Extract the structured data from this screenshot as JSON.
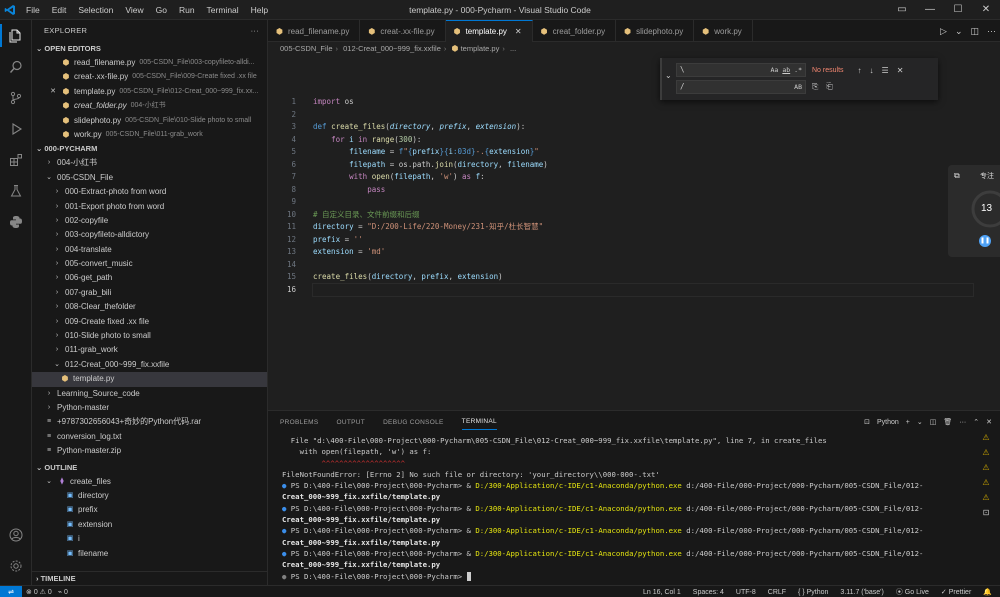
{
  "window": {
    "title": "template.py - 000-Pycharm - Visual Studio Code",
    "menu": [
      "File",
      "Edit",
      "Selection",
      "View",
      "Go",
      "Run",
      "Terminal",
      "Help"
    ]
  },
  "sidebar": {
    "title": "EXPLORER",
    "open_editors_header": "OPEN EDITORS",
    "open_editors": [
      {
        "name": "read_filename.py",
        "desc": "005-CSDN_File\\003-copyfileto-alldi..."
      },
      {
        "name": "creat-.xx-file.py",
        "desc": "005-CSDN_File\\009-Create fixed .xx file"
      },
      {
        "name": "template.py",
        "desc": "005-CSDN_File\\012-Creat_000~999_fix.xx..."
      },
      {
        "name": "creat_folder.py",
        "desc": "004-小红书"
      },
      {
        "name": "slidephoto.py",
        "desc": "005-CSDN_File\\010-Slide photo to small"
      },
      {
        "name": "work.py",
        "desc": "005-CSDN_File\\011-grab_work"
      }
    ],
    "workspace_header": "000-PYCHARM",
    "tree": [
      {
        "label": "004-小红书",
        "depth": 1,
        "kind": "chev-right"
      },
      {
        "label": "005-CSDN_File",
        "depth": 1,
        "kind": "chev-down"
      },
      {
        "label": "000-Extract-photo from word",
        "depth": 2,
        "kind": "chev-right"
      },
      {
        "label": "001-Export photo from word",
        "depth": 2,
        "kind": "chev-right"
      },
      {
        "label": "002-copyfile",
        "depth": 2,
        "kind": "chev-right"
      },
      {
        "label": "003-copyfileto-alldictory",
        "depth": 2,
        "kind": "chev-right"
      },
      {
        "label": "004-translate",
        "depth": 2,
        "kind": "chev-right"
      },
      {
        "label": "005-convert_music",
        "depth": 2,
        "kind": "chev-right"
      },
      {
        "label": "006-get_path",
        "depth": 2,
        "kind": "chev-right"
      },
      {
        "label": "007-grab_bili",
        "depth": 2,
        "kind": "chev-right"
      },
      {
        "label": "008-Clear_thefolder",
        "depth": 2,
        "kind": "chev-right"
      },
      {
        "label": "009-Create fixed .xx file",
        "depth": 2,
        "kind": "chev-right"
      },
      {
        "label": "010-Slide photo to small",
        "depth": 2,
        "kind": "chev-right"
      },
      {
        "label": "011-grab_work",
        "depth": 2,
        "kind": "chev-right"
      },
      {
        "label": "012-Creat_000~999_fix.xxfile",
        "depth": 2,
        "kind": "chev-down"
      },
      {
        "label": "template.py",
        "depth": 3,
        "kind": "py",
        "selected": true
      },
      {
        "label": "Learning_Source_code",
        "depth": 1,
        "kind": "chev-right"
      },
      {
        "label": "Python-master",
        "depth": 1,
        "kind": "chev-right"
      },
      {
        "label": "+9787302656043+奇妙的Python代码.rar",
        "depth": 1,
        "kind": "file"
      },
      {
        "label": "conversion_log.txt",
        "depth": 1,
        "kind": "file"
      },
      {
        "label": "Python-master.zip",
        "depth": 1,
        "kind": "file"
      }
    ],
    "outline_header": "OUTLINE",
    "outline": [
      {
        "label": "create_files",
        "depth": 1,
        "kind": "func"
      },
      {
        "label": "directory",
        "depth": 2,
        "kind": "var"
      },
      {
        "label": "prefix",
        "depth": 2,
        "kind": "var"
      },
      {
        "label": "extension",
        "depth": 2,
        "kind": "var"
      },
      {
        "label": "i",
        "depth": 2,
        "kind": "var"
      },
      {
        "label": "filename",
        "depth": 2,
        "kind": "var"
      }
    ],
    "timeline_header": "TIMELINE"
  },
  "tabs": [
    {
      "label": "read_filename.py",
      "active": false
    },
    {
      "label": "creat-.xx-file.py",
      "active": false
    },
    {
      "label": "template.py",
      "active": true
    },
    {
      "label": "creat_folder.py",
      "active": false
    },
    {
      "label": "slidephoto.py",
      "active": false
    },
    {
      "label": "work.py",
      "active": false
    }
  ],
  "breadcrumb": [
    "005-CSDN_File",
    "012-Creat_000~999_fix.xxfile",
    "template.py",
    "..."
  ],
  "find": {
    "search_value": "\\",
    "replace_value": "/",
    "no_results": "No results",
    "search_opts": [
      "Aa",
      "ab",
      ".*"
    ],
    "replace_opts": [
      "AB"
    ]
  },
  "timer": {
    "label": "专注",
    "value": "13"
  },
  "editor": {
    "current_line": 16,
    "line_numbers": [
      "1",
      "2",
      "3",
      "4",
      "5",
      "6",
      "7",
      "8",
      "9",
      "10",
      "11",
      "12",
      "13",
      "14",
      "15",
      "16"
    ]
  },
  "panel": {
    "tabs": [
      "PROBLEMS",
      "OUTPUT",
      "DEBUG CONSOLE",
      "TERMINAL"
    ],
    "active_tab": "TERMINAL",
    "shell": "Python",
    "terminal_lines": [
      {
        "type": "plain",
        "text": "  File \"d:\\400-File\\000-Project\\000-Pycharm\\005-CSDN_File\\012-Creat_000~999_fix.xxfile\\template.py\", line 7, in create_files"
      },
      {
        "type": "plain",
        "text": "    with open(filepath, 'w') as f:"
      },
      {
        "type": "tilde",
        "text": "         ^^^^^^^^^^^^^^^^^^^"
      },
      {
        "type": "plain",
        "text": "FileNotFoundError: [Errno 2] No such file or directory: 'your_directory\\\\000-000-.txt'"
      },
      {
        "type": "ps",
        "prompt": "PS D:\\400-File\\000-Project\\000-Pycharm> ",
        "amp": "& ",
        "exe": "D:/300-Application/c-IDE/c1-Anaconda/python.exe",
        "arg": " d:/400-File/000-Project/000-Pycharm/005-CSDN_File/012-"
      },
      {
        "type": "bold",
        "text": "Creat_000~999_fix.xxfile/template.py"
      },
      {
        "type": "ps",
        "prompt": "PS D:\\400-File\\000-Project\\000-Pycharm> ",
        "amp": "& ",
        "exe": "D:/300-Application/c-IDE/c1-Anaconda/python.exe",
        "arg": " d:/400-File/000-Project/000-Pycharm/005-CSDN_File/012-"
      },
      {
        "type": "bold",
        "text": "Creat_000~999_fix.xxfile/template.py"
      },
      {
        "type": "ps",
        "prompt": "PS D:\\400-File\\000-Project\\000-Pycharm> ",
        "amp": "& ",
        "exe": "D:/300-Application/c-IDE/c1-Anaconda/python.exe",
        "arg": " d:/400-File/000-Project/000-Pycharm/005-CSDN_File/012-"
      },
      {
        "type": "bold",
        "text": "Creat_000~999_fix.xxfile/template.py"
      },
      {
        "type": "ps",
        "prompt": "PS D:\\400-File\\000-Project\\000-Pycharm> ",
        "amp": "& ",
        "exe": "D:/300-Application/c-IDE/c1-Anaconda/python.exe",
        "arg": " d:/400-File/000-Project/000-Pycharm/005-CSDN_File/012-"
      },
      {
        "type": "bold",
        "text": "Creat_000~999_fix.xxfile/template.py"
      },
      {
        "type": "prompt",
        "text": "PS D:\\400-File\\000-Project\\000-Pycharm> "
      }
    ]
  },
  "status": {
    "errors": "0",
    "warnings": "0",
    "ports": "0",
    "position": "Ln 16, Col 1",
    "spaces": "Spaces: 4",
    "encoding": "UTF-8",
    "eol": "CRLF",
    "language": "Python",
    "interpreter": "3.11.7 ('base')",
    "golive": "Go Live",
    "prettier": "Prettier"
  },
  "colors": {
    "accent": "#0078d4",
    "editor_bg": "#1f1f1f",
    "sidebar_bg": "#181818"
  }
}
